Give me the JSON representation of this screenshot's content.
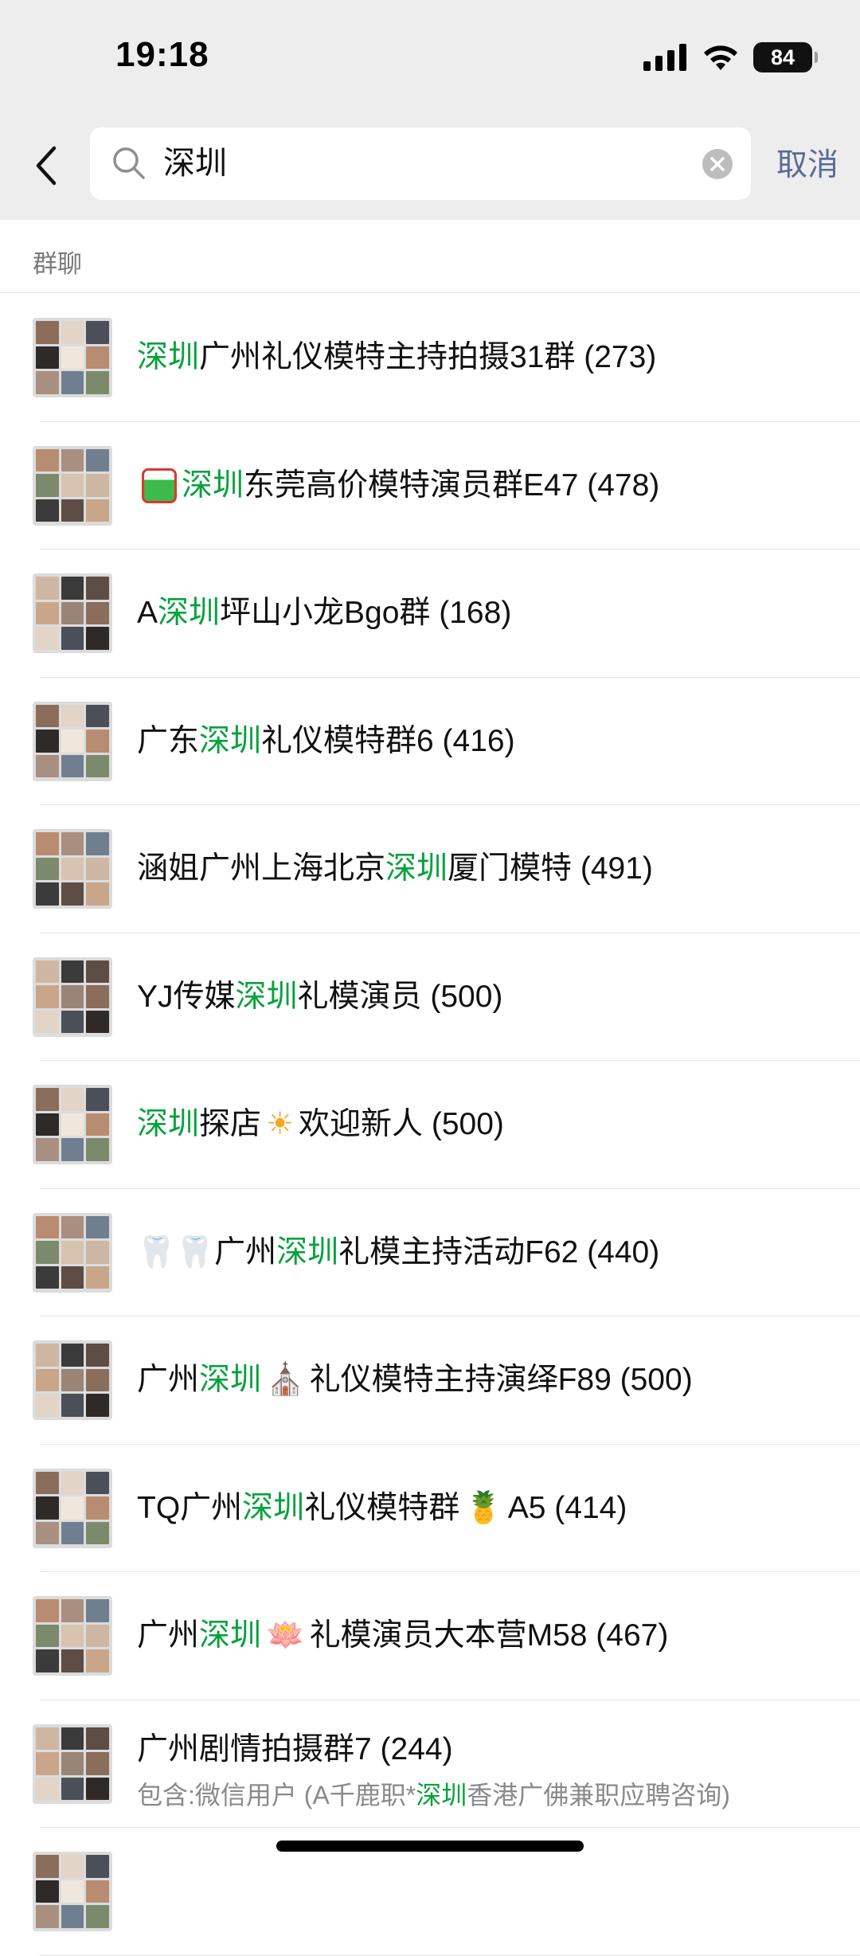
{
  "status_bar": {
    "time": "19:18",
    "battery": "84"
  },
  "search": {
    "query": "深圳",
    "cancel_label": "取消"
  },
  "section": {
    "title": "群聊"
  },
  "groups": [
    {
      "highlight": "深圳",
      "suffix": "广州礼仪模特主持拍摄31群 (273)"
    },
    {
      "highlight": "深圳",
      "suffix": "东莞高价模特演员群E47 (478)"
    },
    {
      "prefix": "A ",
      "highlight": "深圳",
      "suffix": "坪山小龙Bgo群 (168)"
    },
    {
      "prefix": "广东",
      "highlight": "深圳",
      "suffix": "礼仪模特群6 (416)"
    },
    {
      "prefix": "涵姐广州上海北京",
      "highlight": "深圳",
      "suffix": "厦门模特 (491)"
    },
    {
      "prefix": "YJ传媒",
      "highlight": "深圳",
      "suffix": "礼模演员 (500)"
    },
    {
      "highlight": "深圳",
      "mid": "探店 ",
      "emoji": "☀",
      "suffix": " 欢迎新人 (500)"
    },
    {
      "prefix": "🦷🦷广州",
      "highlight": "深圳",
      "suffix": "礼模主持活动F62 (440)"
    },
    {
      "prefix": "广州",
      "highlight": "深圳",
      "emoji": "⛪",
      "suffix": "礼仪模特主持演绎F89 (500)"
    },
    {
      "prefix": "TQ广州",
      "highlight": "深圳",
      "suffix": "礼仪模特群",
      "emoji": "🍍",
      "tail": "  A5 (414)"
    },
    {
      "prefix": "广州",
      "highlight": "深圳",
      "emoji": "🪷",
      "suffix": "礼模演员大本营M58 (467)"
    },
    {
      "title": "广州剧情拍摄群7 (244)",
      "sub_prefix": "包含:微信用户 (A千鹿职*",
      "sub_highlight": "深圳",
      "sub_suffix": "香港广佛兼职应聘咨询)"
    }
  ]
}
